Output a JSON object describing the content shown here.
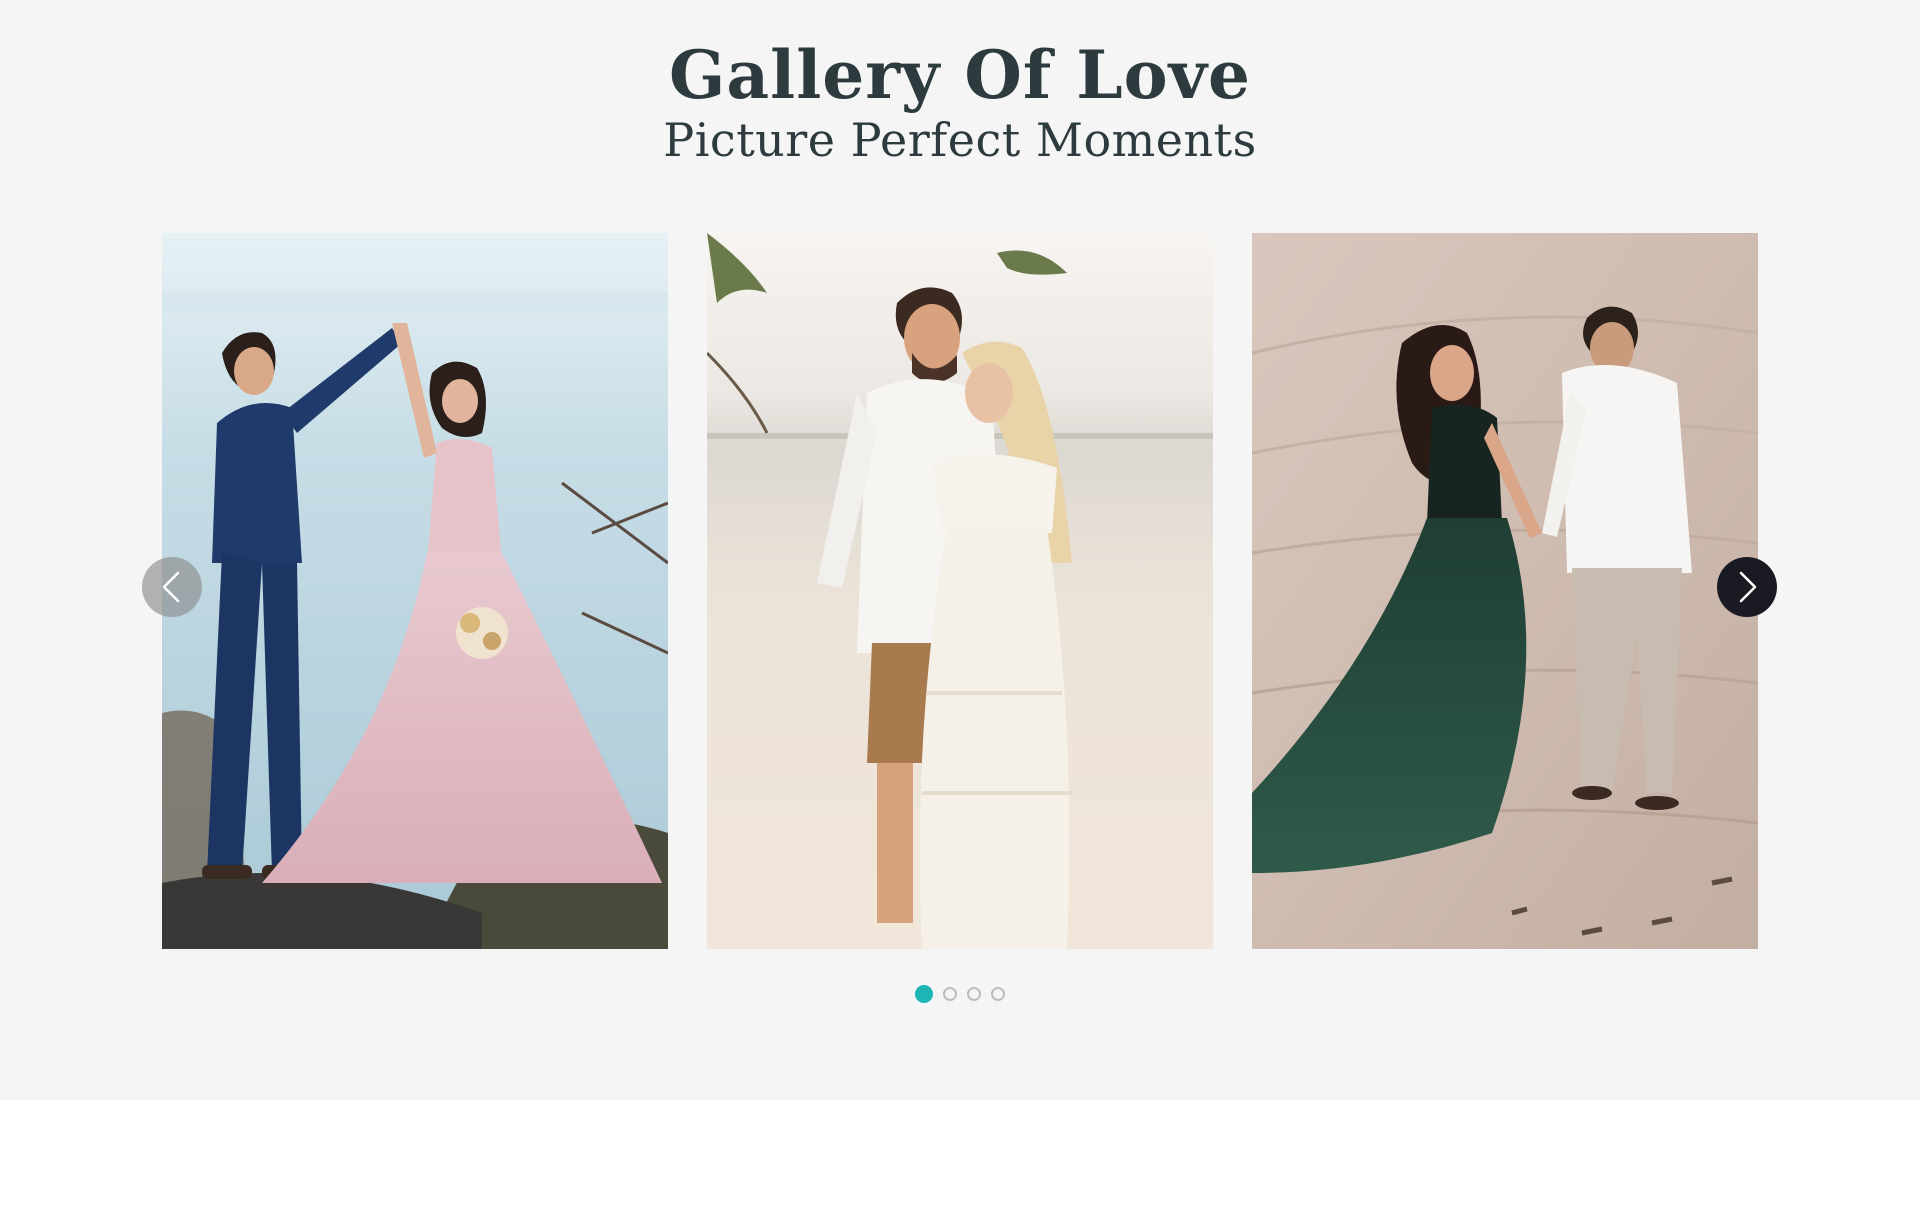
{
  "gallery": {
    "title": "Gallery Of Love",
    "subtitle": "Picture Perfect Moments",
    "slides": [
      {
        "alt": "Couple dancing on a seaside cliff, bride in pink tulle gown"
      },
      {
        "alt": "Couple holding hands on a sandy beach, bride in white lace dress"
      },
      {
        "alt": "Couple walking across desert dunes, bride in dark green gown"
      }
    ],
    "prev_icon": "chevron-left-icon",
    "next_icon": "chevron-right-icon",
    "pagination": {
      "count": 4,
      "active_index": 0
    },
    "colors": {
      "heading": "#2d3b3f",
      "section_background": "#f5f5f5",
      "active_dot": "#1fb5b5",
      "next_arrow": "#1a1a22",
      "prev_arrow": "#8c8c8c"
    }
  }
}
